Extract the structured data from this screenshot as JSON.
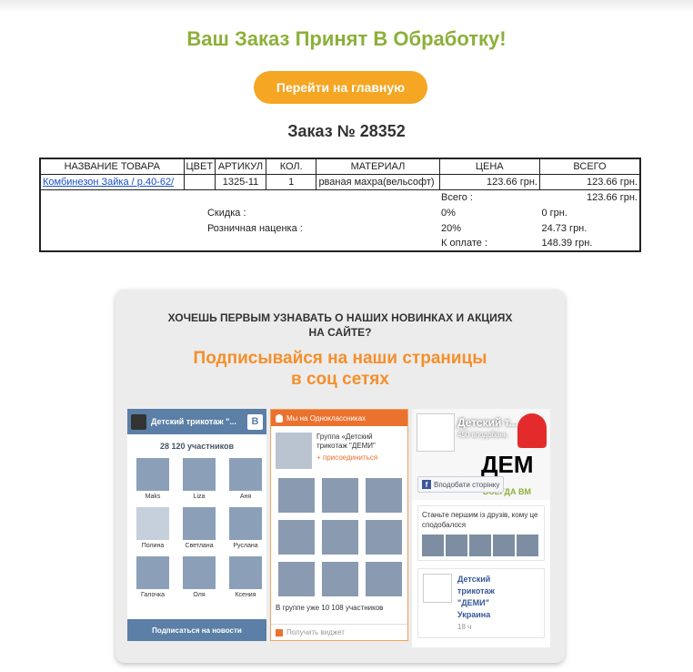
{
  "page": {
    "title": "Ваш Заказ Принят В Обработку!",
    "home_button": "Перейти на главную",
    "order_number": "Заказ № 28352"
  },
  "order_table": {
    "headers": [
      "НАЗВАНИЕ ТОВАРА",
      "ЦВЕТ",
      "АРТИКУЛ",
      "КОЛ.",
      "МАТЕРИАЛ",
      "ЦЕНА",
      "ВСЕГО"
    ],
    "item": {
      "name": "Комбинезон Зайка / р.40-62/",
      "color": "",
      "sku": "1325-11",
      "qty": "1",
      "material": "рваная махра(вельсофт)",
      "price": "123.66 грн.",
      "total": "123.66 грн."
    },
    "subtotal_label": "Всего :",
    "subtotal_value": "123.66 грн.",
    "discount_label": "Скидка :",
    "discount_percent": "0%",
    "discount_value": "0 грн.",
    "markup_label": "Розничная наценка :",
    "markup_percent": "20%",
    "markup_value": "24.73 грн.",
    "pay_label": "К оплате :",
    "pay_value": "148.39 грн."
  },
  "promo": {
    "line1": "ХОЧЕШЬ ПЕРВЫМ УЗНАВАТЬ О НАШИХ НОВИНКАХ И АКЦИЯХ",
    "line2": "НА САЙТЕ?",
    "headline1": "Подписывайся на наши страницы",
    "headline2": "в соц сетях"
  },
  "vk": {
    "group_name": "Детский трикотаж \"...",
    "badge": "В",
    "members_count": "28 120 участников",
    "members": [
      "Maks",
      "Liza",
      "Аня",
      "Полина",
      "Светлана",
      "Руслана",
      "Галочка",
      "Оля",
      "Ксения"
    ],
    "subscribe_button": "Подписаться на новости"
  },
  "ok": {
    "header": "Мы на Одноклассниках",
    "group_name_line1": "Группа «Детский",
    "group_name_line2": "трикотаж \"ДЕМИ\"",
    "join": "+ присоединиться",
    "members_text": "В группе уже 10 108 участников",
    "get_widget": "Получить виджет"
  },
  "fb": {
    "page_name": "Детский т...",
    "likes": "450 вподобань",
    "cover_text": "ДЕМ",
    "cover_subtext": "ВСЕГДА ВМ",
    "like_button": "Вподобати сторінку",
    "friends_text": "Станьте першим із друзів, кому це сподобалося",
    "post_title_lines": [
      "Детский",
      "трикотаж",
      "\"ДЕМИ\"",
      "Украина"
    ],
    "post_time": "18 ч"
  },
  "colors": {
    "title_green": "#8cb03a",
    "button_orange": "#f5a623",
    "headline_orange": "#f58f2a",
    "vk_blue": "#5b7fa6",
    "ok_orange": "#eb722e",
    "fb_blue": "#3b5998"
  }
}
